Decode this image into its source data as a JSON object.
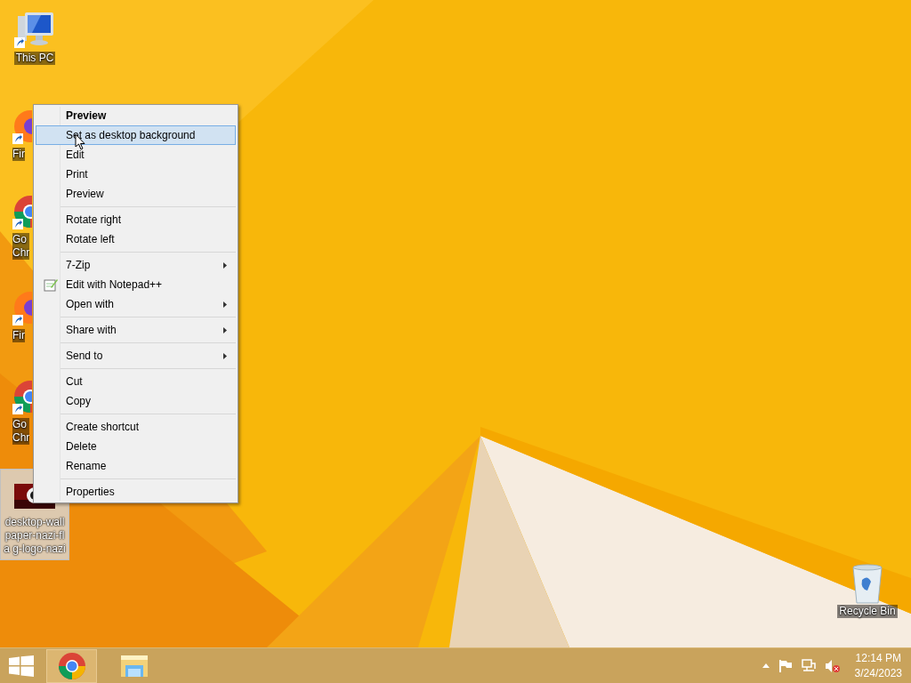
{
  "desktop": {
    "icons": [
      {
        "kind": "computer",
        "label": "This PC",
        "selected": false
      },
      {
        "kind": "firefox",
        "label": "Fir",
        "selected": false
      },
      {
        "kind": "chrome",
        "label": "Go\nChr",
        "selected": false
      },
      {
        "kind": "firefox",
        "label": "Fir",
        "selected": false
      },
      {
        "kind": "chrome",
        "label": "Go\nChr",
        "selected": false
      },
      {
        "label": "desktop-wall paper-nazi-fla g-logo-nazi",
        "selected": true
      },
      {
        "kind": "recycle",
        "label": "Recycle Bin",
        "selected": false
      }
    ]
  },
  "context_menu": {
    "items": [
      {
        "kind": "item",
        "label": "Preview",
        "default": true,
        "selected": false,
        "submenu": false,
        "has_icon": false
      },
      {
        "kind": "item",
        "label": "Set as desktop background",
        "default": false,
        "selected": true,
        "submenu": false,
        "has_icon": false
      },
      {
        "kind": "item",
        "label": "Edit",
        "default": false,
        "selected": false,
        "submenu": false,
        "has_icon": false
      },
      {
        "kind": "item",
        "label": "Print",
        "default": false,
        "selected": false,
        "submenu": false,
        "has_icon": false
      },
      {
        "kind": "item",
        "label": "Preview",
        "default": false,
        "selected": false,
        "submenu": false,
        "has_icon": false
      },
      {
        "kind": "separator"
      },
      {
        "kind": "item",
        "label": "Rotate right",
        "default": false,
        "selected": false,
        "submenu": false,
        "has_icon": false
      },
      {
        "kind": "item",
        "label": "Rotate left",
        "default": false,
        "selected": false,
        "submenu": false,
        "has_icon": false
      },
      {
        "kind": "separator"
      },
      {
        "kind": "item",
        "label": "7-Zip",
        "default": false,
        "selected": false,
        "submenu": true,
        "has_icon": false
      },
      {
        "kind": "item",
        "label": "Edit with Notepad++",
        "default": false,
        "selected": false,
        "submenu": false,
        "has_icon": true
      },
      {
        "kind": "item",
        "label": "Open with",
        "default": false,
        "selected": false,
        "submenu": true,
        "has_icon": false
      },
      {
        "kind": "separator"
      },
      {
        "kind": "item",
        "label": "Share with",
        "default": false,
        "selected": false,
        "submenu": true,
        "has_icon": false
      },
      {
        "kind": "separator"
      },
      {
        "kind": "item",
        "label": "Send to",
        "default": false,
        "selected": false,
        "submenu": true,
        "has_icon": false
      },
      {
        "kind": "separator"
      },
      {
        "kind": "item",
        "label": "Cut",
        "default": false,
        "selected": false,
        "submenu": false,
        "has_icon": false
      },
      {
        "kind": "item",
        "label": "Copy",
        "default": false,
        "selected": false,
        "submenu": false,
        "has_icon": false
      },
      {
        "kind": "separator"
      },
      {
        "kind": "item",
        "label": "Create shortcut",
        "default": false,
        "selected": false,
        "submenu": false,
        "has_icon": false
      },
      {
        "kind": "item",
        "label": "Delete",
        "default": false,
        "selected": false,
        "submenu": false,
        "has_icon": false
      },
      {
        "kind": "item",
        "label": "Rename",
        "default": false,
        "selected": false,
        "submenu": false,
        "has_icon": false
      },
      {
        "kind": "separator"
      },
      {
        "kind": "item",
        "label": "Properties",
        "default": false,
        "selected": false,
        "submenu": false,
        "has_icon": false
      }
    ]
  },
  "taskbar": {
    "apps": [
      {
        "kind": "chrome",
        "selected": true
      },
      {
        "kind": "explorer",
        "selected": false
      }
    ],
    "clock": {
      "time": "12:14 PM",
      "date": "3/24/2023"
    }
  }
}
